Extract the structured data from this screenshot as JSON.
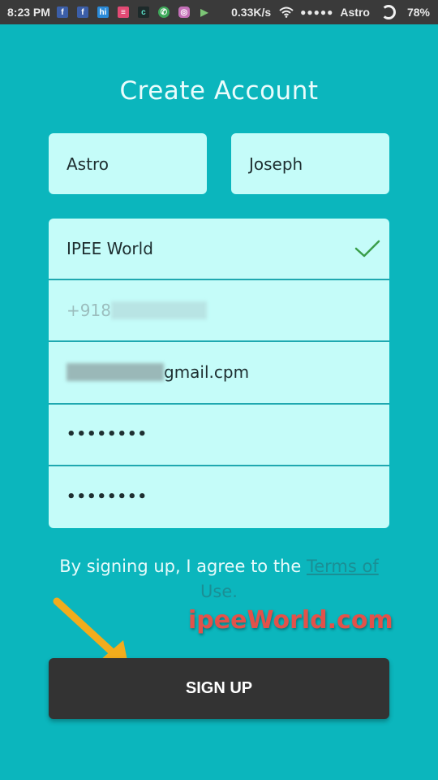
{
  "status_bar": {
    "time": "8:23 PM",
    "notification_icons": [
      {
        "name": "facebook-icon",
        "glyph": "f"
      },
      {
        "name": "facebook-icon",
        "glyph": "f"
      },
      {
        "name": "hike-icon",
        "glyph": "hi"
      },
      {
        "name": "message-icon",
        "glyph": "≡"
      },
      {
        "name": "clock-app-icon",
        "glyph": "c"
      },
      {
        "name": "whatsapp-icon",
        "glyph": "✆"
      },
      {
        "name": "instagram-icon",
        "glyph": "◎"
      },
      {
        "name": "play-store-icon",
        "glyph": "▶"
      }
    ],
    "network_speed": "0.33K/s",
    "signal_dots": "●●●●●",
    "carrier": "Astro",
    "battery": "78%"
  },
  "form": {
    "title": "Create Account",
    "first_name": "Astro",
    "last_name": "Joseph",
    "organization": "IPEE World",
    "phone_visible_prefix": "+918",
    "email_visible_suffix": "gmail.cpm",
    "password": "••••••••",
    "confirm_password": "••••••••",
    "terms_text": "By signing up, I agree to the ",
    "terms_link": "Terms of",
    "terms_link_cont": "Use.",
    "submit_label": "SIGN UP"
  },
  "overlay": {
    "watermark": "ipeeWorld.com",
    "arrow_color": "#f2ac1c"
  },
  "colors": {
    "background": "#0bb6bd",
    "field": "#c5fcf9",
    "button": "#333333",
    "check": "#3a9e4a"
  }
}
